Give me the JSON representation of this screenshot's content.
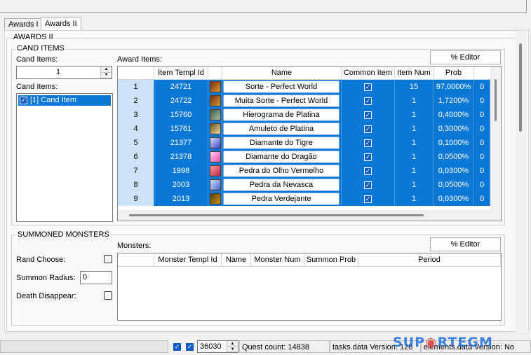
{
  "tabs": [
    "Awards I",
    "Awards II"
  ],
  "awards_group": "AWARDS II",
  "cand_items": {
    "group_label": "CAND ITEMS",
    "count_label": "Cand Items:",
    "count_value": "1",
    "list_label": "Cand Items:",
    "list": [
      "[1] Cand Item"
    ]
  },
  "award_items": {
    "label": "Award Items:",
    "editor_button": "% Editor",
    "columns": [
      "Item Templ Id",
      "",
      "Name",
      "Common Item",
      "Item Num",
      "Prob"
    ],
    "rows": [
      {
        "n": "1",
        "id": "24721",
        "icon": "scroll-icon",
        "name": "Sorte - Perfect World",
        "num": "15",
        "prob": "97,0000%",
        "extra": "0"
      },
      {
        "n": "2",
        "id": "24722",
        "icon": "scroll-icon",
        "name": "Muita Sorte - Perfect World",
        "num": "1",
        "prob": "1,7200%",
        "extra": "0"
      },
      {
        "n": "3",
        "id": "15760",
        "icon": "tablet-icon",
        "name": "Hierograma de Platina",
        "num": "1",
        "prob": "0,4000%",
        "extra": "0"
      },
      {
        "n": "4",
        "id": "15761",
        "icon": "amulet-icon",
        "name": "Amuleto de Platina",
        "num": "1",
        "prob": "0,3000%",
        "extra": "0"
      },
      {
        "n": "5",
        "id": "21377",
        "icon": "diamond-icon",
        "name": "Diamante do Tigre",
        "num": "1",
        "prob": "0,1000%",
        "extra": "0"
      },
      {
        "n": "6",
        "id": "21378",
        "icon": "gem-icon",
        "name": "Diamante do Dragão",
        "num": "1",
        "prob": "0,0500%",
        "extra": "0"
      },
      {
        "n": "7",
        "id": "1998",
        "icon": "red-stone-icon",
        "name": "Pedra do Olho Vermelho",
        "num": "1",
        "prob": "0,0300%",
        "extra": "0"
      },
      {
        "n": "8",
        "id": "2003",
        "icon": "ice-stone-icon",
        "name": "Pedra da Nevasca",
        "num": "1",
        "prob": "0,0500%",
        "extra": "0"
      },
      {
        "n": "9",
        "id": "2013",
        "icon": "green-stone-icon",
        "name": "Pedra Verdejante",
        "num": "1",
        "prob": "0,0300%",
        "extra": "0"
      }
    ]
  },
  "summoned": {
    "group_label": "SUMMONED MONSTERS",
    "rand_choose": "Rand Choose:",
    "summon_radius": "Summon Radius:",
    "summon_radius_value": "0",
    "death_disappear": "Death Disappear:",
    "monsters_label": "Monsters:",
    "editor_button": "% Editor",
    "columns": [
      "Monster Templ Id",
      "Name",
      "Monster Num",
      "Summon Prob",
      "Period"
    ]
  },
  "status": {
    "task_id": "36030",
    "quest_count": "Quest count: 14838",
    "tasks_version": "tasks.data Version: 128",
    "elements_version": "elements.data Version: No"
  },
  "watermark": {
    "text1": "SUP",
    "text2": "RTEGM"
  },
  "colors": {
    "selection": "#0a78d7",
    "row_header": "#cce3f6"
  }
}
